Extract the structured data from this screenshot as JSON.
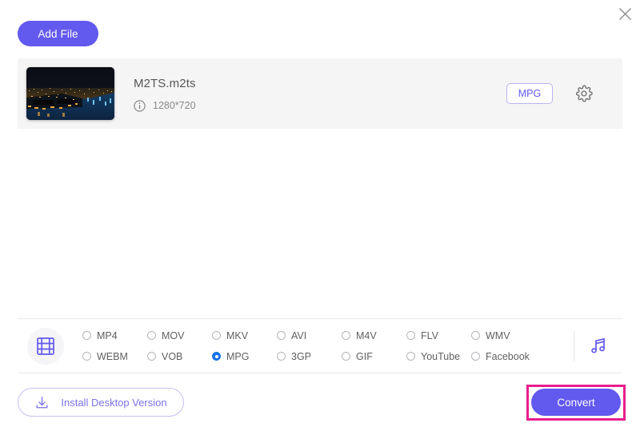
{
  "window": {
    "close_label": "×",
    "close_icon": "close-icon"
  },
  "toolbar": {
    "add_file_label": "Add File"
  },
  "file_list": {
    "files": [
      {
        "name": "M2TS.m2ts",
        "resolution": "1280*720",
        "info_icon": "info-circle-icon",
        "thumbnail_alt": "night aerial city harbor",
        "output_format_badge": "MPG",
        "settings_icon": "gear-icon"
      }
    ]
  },
  "format_picker": {
    "video_icon": "film-strip-icon",
    "audio_icon": "music-note-icon",
    "selected": "MPG",
    "options": [
      "MP4",
      "MOV",
      "MKV",
      "AVI",
      "M4V",
      "FLV",
      "WMV",
      "WEBM",
      "VOB",
      "MPG",
      "3GP",
      "GIF",
      "YouTube",
      "Facebook"
    ]
  },
  "footer": {
    "install_label": "Install Desktop Version",
    "install_icon": "download-icon",
    "convert_label": "Convert"
  },
  "colors": {
    "accent": "#6259ee",
    "panel": "#f5f5f6",
    "radio_selected": "#1a73e8",
    "highlight": "#e71d8e",
    "divider": "#e9e9eb"
  }
}
